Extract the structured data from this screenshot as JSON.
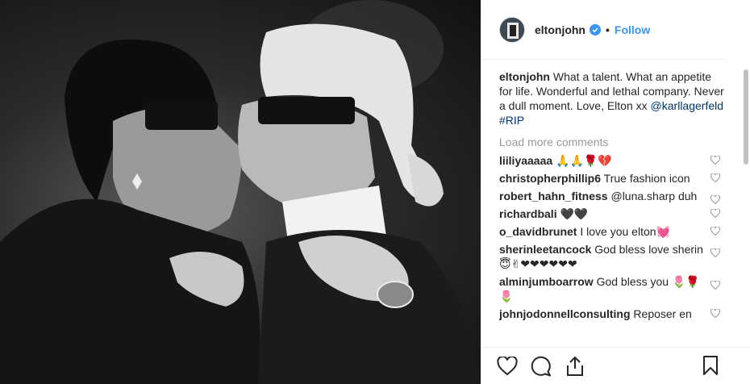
{
  "post": {
    "username": "eltonjohn",
    "follow_label": "Follow",
    "separator": "•"
  },
  "caption": {
    "username": "eltonjohn",
    "text": "What a talent. What an appetite for life. Wonderful and lethal company. Never a dull moment. Love, Elton xx",
    "mention": "@karllagerfeld",
    "hashtag": "#RIP"
  },
  "load_more_label": "Load more comments",
  "comments": [
    {
      "username": "liiliyaaaaa",
      "text": "🙏🙏🌹💔"
    },
    {
      "username": "christopherphillip6",
      "text": "True fashion icon"
    },
    {
      "username": "robert_hahn_fitness",
      "text": "@luna.sharp duh"
    },
    {
      "username": "richardbali",
      "text": "🖤🖤"
    },
    {
      "username": "o_davidbrunet",
      "text": "I love you elton💓"
    },
    {
      "username": "sherinleetancock",
      "text": "God bless love sherin 😇✌❤❤❤❤❤❤"
    },
    {
      "username": "alminjumboarrow",
      "text": "God bless you 🌷🌹🌷"
    },
    {
      "username": "johnjodonnellconsulting",
      "text": "Reposer en"
    }
  ],
  "icons": {
    "like": "heart-outline-icon",
    "comment": "speech-bubble-icon",
    "share": "share-icon",
    "save": "bookmark-icon",
    "verified": "verified-badge-icon"
  },
  "colors": {
    "link": "#3897f0",
    "muted": "#999999",
    "text": "#262626"
  }
}
